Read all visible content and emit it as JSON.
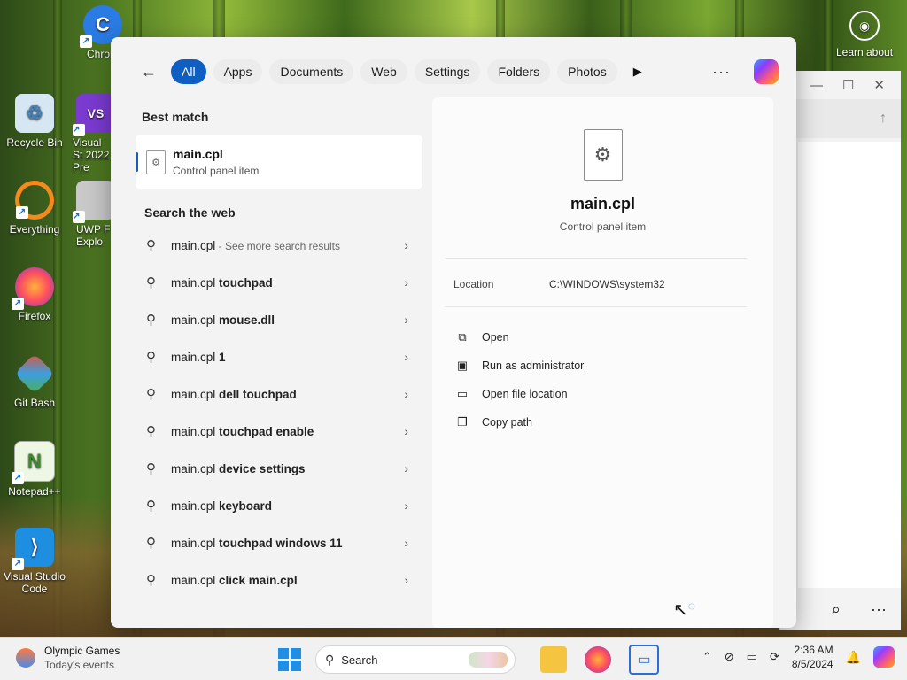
{
  "desktop": {
    "icons": [
      {
        "label": "Chrom",
        "glyph": "C",
        "color": "#2a7be4"
      },
      {
        "label": "Recycle Bin",
        "glyph": "♲",
        "color": "#5aa0d8"
      },
      {
        "label": "Visual St 2022 Pre",
        "glyph": "VS",
        "color": "#7b3bd1"
      },
      {
        "label": "Everything",
        "glyph": "O",
        "color": "#f28a1d"
      },
      {
        "label": "UWP F Explo",
        "glyph": "▭",
        "color": "#c9c9c9"
      },
      {
        "label": "Firefox",
        "glyph": "ƒ",
        "color": "#ff6a2b"
      },
      {
        "label": "Git Bash",
        "glyph": "◆",
        "color": "#e0543a"
      },
      {
        "label": "Notepad++",
        "glyph": "N",
        "color": "#8fd06a"
      },
      {
        "label": "Visual Studio Code",
        "glyph": "⟩",
        "color": "#1e8fe0"
      }
    ],
    "learn_label": "Learn about"
  },
  "search_panel": {
    "filters": [
      "All",
      "Apps",
      "Documents",
      "Web",
      "Settings",
      "Folders",
      "Photos"
    ],
    "best_match_title": "Best match",
    "best_match": {
      "name": "main.cpl",
      "type": "Control panel item"
    },
    "web_title": "Search the web",
    "web_results": [
      {
        "base": "main.cpl",
        "suffix": "",
        "hint": " - See more search results"
      },
      {
        "base": "main.cpl ",
        "suffix": "touchpad",
        "hint": ""
      },
      {
        "base": "main.cpl ",
        "suffix": "mouse.dll",
        "hint": ""
      },
      {
        "base": "main.cpl ",
        "suffix": "1",
        "hint": ""
      },
      {
        "base": "main.cpl ",
        "suffix": "dell touchpad",
        "hint": ""
      },
      {
        "base": "main.cpl ",
        "suffix": "touchpad enable",
        "hint": ""
      },
      {
        "base": "main.cpl ",
        "suffix": "device settings",
        "hint": ""
      },
      {
        "base": "main.cpl ",
        "suffix": "keyboard",
        "hint": ""
      },
      {
        "base": "main.cpl ",
        "suffix": "touchpad windows 11",
        "hint": ""
      },
      {
        "base": "main.cpl ",
        "suffix": "click main.cpl",
        "hint": ""
      }
    ],
    "preview": {
      "name": "main.cpl",
      "type": "Control panel item",
      "location_label": "Location",
      "location_value": "C:\\WINDOWS\\system32",
      "actions": [
        {
          "label": "Open",
          "icon": "open-external-icon"
        },
        {
          "label": "Run as administrator",
          "icon": "shield-admin-icon"
        },
        {
          "label": "Open file location",
          "icon": "folder-icon"
        },
        {
          "label": "Copy path",
          "icon": "copy-icon"
        }
      ]
    }
  },
  "taskbar": {
    "weather_title": "Olympic Games",
    "weather_sub": "Today's events",
    "search_label": "Search",
    "time": "2:36 AM",
    "date": "8/5/2024"
  },
  "colors": {
    "accent": "#0f5fc2",
    "panel_bg": "#f3f3f3"
  }
}
